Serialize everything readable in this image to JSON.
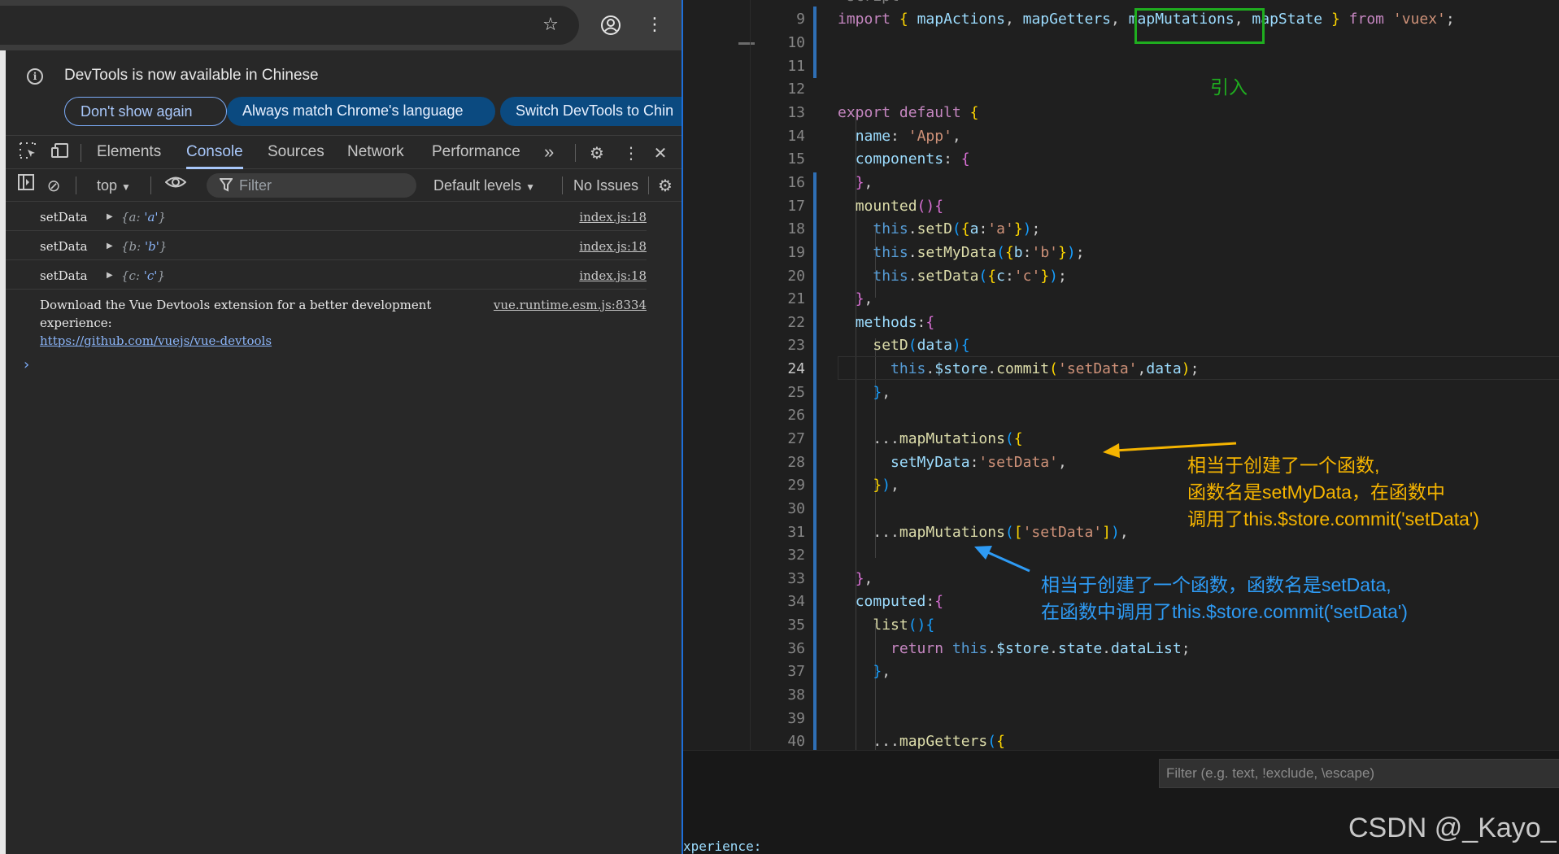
{
  "chrome": {
    "icons": [
      "star-icon",
      "account-icon",
      "more-vert-icon"
    ]
  },
  "infobar": {
    "message": "DevTools is now available in Chinese",
    "dont_show": "Don't show again",
    "always_match": "Always match Chrome's language",
    "switch_lang": "Switch DevTools to Chin"
  },
  "devtools": {
    "tabs": [
      "Elements",
      "Console",
      "Sources",
      "Network",
      "Performance"
    ],
    "active_tab": "Console",
    "more_tabs": "»",
    "toolbar": {
      "context": "top",
      "filter_placeholder": "Filter",
      "levels": "Default levels",
      "issues": "No Issues"
    }
  },
  "console": {
    "logs": [
      {
        "msg": "setData",
        "key": "a",
        "val": "'a'",
        "src": "index.js:18"
      },
      {
        "msg": "setData",
        "key": "b",
        "val": "'b'",
        "src": "index.js:18"
      },
      {
        "msg": "setData",
        "key": "c",
        "val": "'c'",
        "src": "index.js:18"
      }
    ],
    "long_msg": "Download the Vue Devtools extension for a better development experience:",
    "long_link": "https://github.com/vuejs/vue-devtools",
    "long_src": "vue.runtime.esm.js:8334",
    "prompt": "›"
  },
  "editor": {
    "partial_top": "<script>",
    "line_numbers": [
      "9",
      "10",
      "11",
      "12",
      "13",
      "14",
      "15",
      "16",
      "17",
      "18",
      "19",
      "20",
      "21",
      "22",
      "23",
      "24",
      "25",
      "26",
      "27",
      "28",
      "29",
      "30",
      "31",
      "32",
      "33",
      "34",
      "35",
      "36",
      "37",
      "38",
      "39",
      "40"
    ],
    "active_line": "24",
    "panel_filter_placeholder": "Filter (e.g. text, !exclude, \\escape)",
    "panel_fragment": "xperience:"
  },
  "annotations": {
    "import_label": "引入",
    "yellow": [
      "相当于创建了一个函数,",
      "函数名是setMyData，在函数中",
      "调用了this.$store.commit('setData')"
    ],
    "blue": [
      "相当于创建了一个函数，函数名是setData,",
      "在函数中调用了this.$store.commit('setData')"
    ]
  },
  "watermark": "CSDN @_Kayo_",
  "colors": {
    "highlight_box": "#1fae1f",
    "yellow_annotation": "#f5b400",
    "blue_annotation": "#2e9bf5",
    "console_tab": "#a8c7fa"
  }
}
